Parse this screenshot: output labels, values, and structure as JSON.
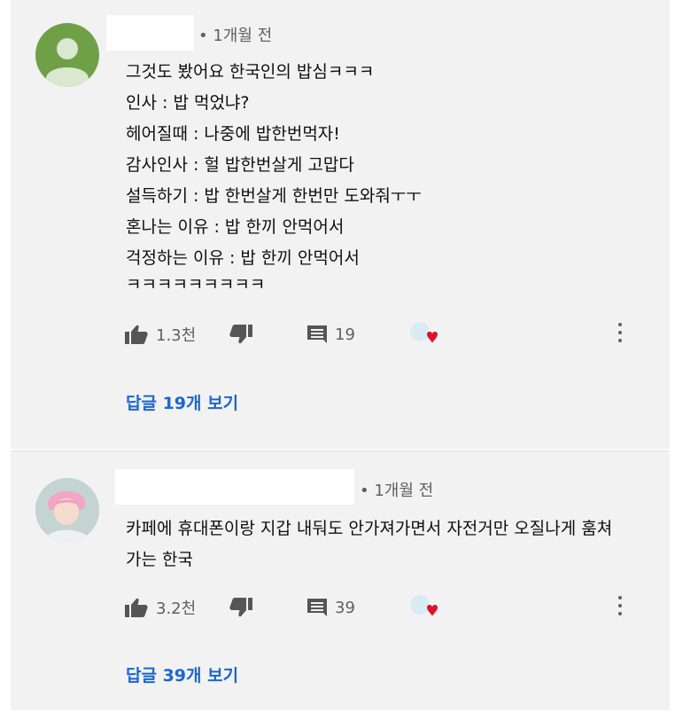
{
  "comments": [
    {
      "time": "• 1개월 전",
      "lines": [
        "그것도 봤어요 한국인의 밥심ㅋㅋㅋ",
        "인사 : 밥 먹었냐?",
        "헤어질때 : 나중에 밥한번먹자!",
        "감사인사 : 헐 밥한번살게 고맙다",
        "설득하기 : 밥 한번살게 한번만 도와줘ㅜㅜ",
        "혼나는 이유 : 밥 한끼 안먹어서",
        "걱정하는 이유 : 밥 한끼 안먹어서",
        "ㅋㅋㅋㅋㅋㅋㅋㅋㅋ"
      ],
      "likes": "1.3천",
      "reply_count": "19",
      "view_replies": "답글 19개 보기"
    },
    {
      "time": "• 1개월 전",
      "lines": [
        "카페에 휴대폰이랑 지갑 내둬도 안가져가면서 자전거만 오질나게 훔쳐",
        "가는 한국"
      ],
      "likes": "3.2천",
      "reply_count": "39",
      "view_replies": "답글 39개 보기"
    }
  ],
  "icons": {
    "like": "thumbs-up-icon",
    "dislike": "thumbs-down-icon",
    "reply": "reply-comment-icon",
    "creator_heart": "creator-heart-icon",
    "more": "more-vertical-icon"
  },
  "colors": {
    "link": "#1a66d2",
    "heart": "#e0112b",
    "avatar_green": "#6fa048",
    "panel": "#f2f2f2"
  }
}
